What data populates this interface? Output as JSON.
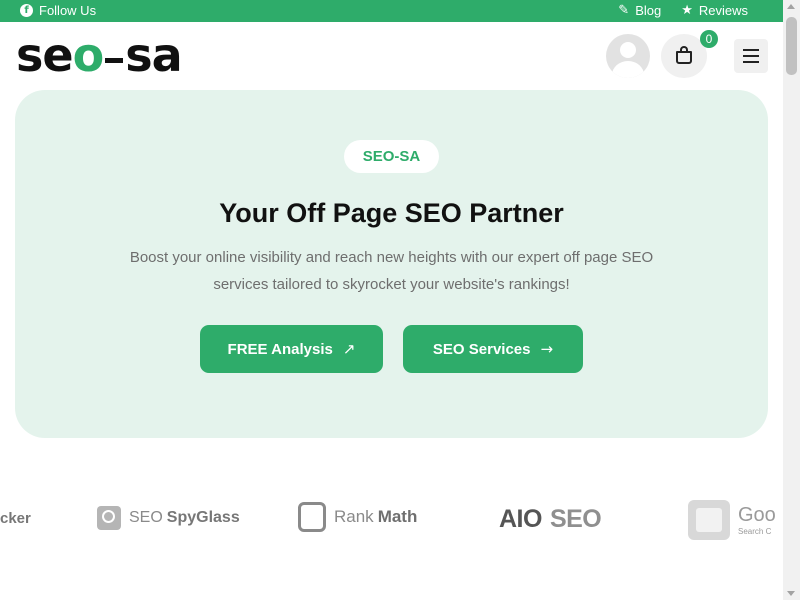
{
  "topbar": {
    "follow_label": "Follow Us",
    "facebook_glyph": "f",
    "blog_label": "Blog",
    "reviews_label": "Reviews",
    "bg_color": "#2eac6a"
  },
  "header": {
    "logo_part1": "se",
    "logo_part2": "o",
    "logo_part3": "sa",
    "cart_count": "0"
  },
  "hero": {
    "badge": "SEO-SA",
    "title": "Your Off Page SEO Partner",
    "description": "Boost your online visibility and reach new heights with our expert off page SEO services tailored to skyrocket your website's rankings!",
    "btn_primary": "FREE Analysis",
    "btn_secondary": "SEO Services",
    "accent": "#2eac6a",
    "bg": "#e4f3ec"
  },
  "brands": {
    "b1": "cker",
    "b2_light": "SEO",
    "b2_bold": "SpyGlass",
    "b3_light": "Rank",
    "b3_bold": "Math",
    "b4_a": "AIO",
    "b4_b": "SEO",
    "b5_main": "Goo",
    "b5_sub": "Search C"
  }
}
